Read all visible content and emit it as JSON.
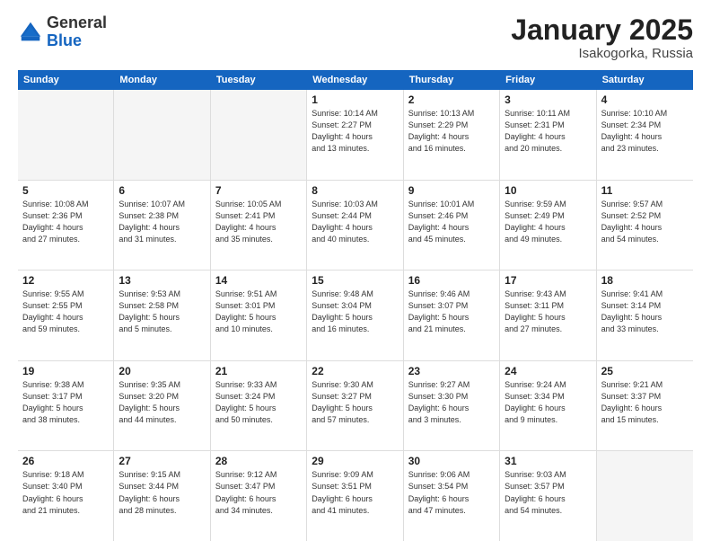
{
  "header": {
    "logo_general": "General",
    "logo_blue": "Blue",
    "month_title": "January 2025",
    "location": "Isakogorka, Russia"
  },
  "days_of_week": [
    "Sunday",
    "Monday",
    "Tuesday",
    "Wednesday",
    "Thursday",
    "Friday",
    "Saturday"
  ],
  "weeks": [
    [
      {
        "day": "",
        "info": "",
        "empty": true
      },
      {
        "day": "",
        "info": "",
        "empty": true
      },
      {
        "day": "",
        "info": "",
        "empty": true
      },
      {
        "day": "1",
        "info": "Sunrise: 10:14 AM\nSunset: 2:27 PM\nDaylight: 4 hours\nand 13 minutes.",
        "empty": false
      },
      {
        "day": "2",
        "info": "Sunrise: 10:13 AM\nSunset: 2:29 PM\nDaylight: 4 hours\nand 16 minutes.",
        "empty": false
      },
      {
        "day": "3",
        "info": "Sunrise: 10:11 AM\nSunset: 2:31 PM\nDaylight: 4 hours\nand 20 minutes.",
        "empty": false
      },
      {
        "day": "4",
        "info": "Sunrise: 10:10 AM\nSunset: 2:34 PM\nDaylight: 4 hours\nand 23 minutes.",
        "empty": false
      }
    ],
    [
      {
        "day": "5",
        "info": "Sunrise: 10:08 AM\nSunset: 2:36 PM\nDaylight: 4 hours\nand 27 minutes.",
        "empty": false
      },
      {
        "day": "6",
        "info": "Sunrise: 10:07 AM\nSunset: 2:38 PM\nDaylight: 4 hours\nand 31 minutes.",
        "empty": false
      },
      {
        "day": "7",
        "info": "Sunrise: 10:05 AM\nSunset: 2:41 PM\nDaylight: 4 hours\nand 35 minutes.",
        "empty": false
      },
      {
        "day": "8",
        "info": "Sunrise: 10:03 AM\nSunset: 2:44 PM\nDaylight: 4 hours\nand 40 minutes.",
        "empty": false
      },
      {
        "day": "9",
        "info": "Sunrise: 10:01 AM\nSunset: 2:46 PM\nDaylight: 4 hours\nand 45 minutes.",
        "empty": false
      },
      {
        "day": "10",
        "info": "Sunrise: 9:59 AM\nSunset: 2:49 PM\nDaylight: 4 hours\nand 49 minutes.",
        "empty": false
      },
      {
        "day": "11",
        "info": "Sunrise: 9:57 AM\nSunset: 2:52 PM\nDaylight: 4 hours\nand 54 minutes.",
        "empty": false
      }
    ],
    [
      {
        "day": "12",
        "info": "Sunrise: 9:55 AM\nSunset: 2:55 PM\nDaylight: 4 hours\nand 59 minutes.",
        "empty": false
      },
      {
        "day": "13",
        "info": "Sunrise: 9:53 AM\nSunset: 2:58 PM\nDaylight: 5 hours\nand 5 minutes.",
        "empty": false
      },
      {
        "day": "14",
        "info": "Sunrise: 9:51 AM\nSunset: 3:01 PM\nDaylight: 5 hours\nand 10 minutes.",
        "empty": false
      },
      {
        "day": "15",
        "info": "Sunrise: 9:48 AM\nSunset: 3:04 PM\nDaylight: 5 hours\nand 16 minutes.",
        "empty": false
      },
      {
        "day": "16",
        "info": "Sunrise: 9:46 AM\nSunset: 3:07 PM\nDaylight: 5 hours\nand 21 minutes.",
        "empty": false
      },
      {
        "day": "17",
        "info": "Sunrise: 9:43 AM\nSunset: 3:11 PM\nDaylight: 5 hours\nand 27 minutes.",
        "empty": false
      },
      {
        "day": "18",
        "info": "Sunrise: 9:41 AM\nSunset: 3:14 PM\nDaylight: 5 hours\nand 33 minutes.",
        "empty": false
      }
    ],
    [
      {
        "day": "19",
        "info": "Sunrise: 9:38 AM\nSunset: 3:17 PM\nDaylight: 5 hours\nand 38 minutes.",
        "empty": false
      },
      {
        "day": "20",
        "info": "Sunrise: 9:35 AM\nSunset: 3:20 PM\nDaylight: 5 hours\nand 44 minutes.",
        "empty": false
      },
      {
        "day": "21",
        "info": "Sunrise: 9:33 AM\nSunset: 3:24 PM\nDaylight: 5 hours\nand 50 minutes.",
        "empty": false
      },
      {
        "day": "22",
        "info": "Sunrise: 9:30 AM\nSunset: 3:27 PM\nDaylight: 5 hours\nand 57 minutes.",
        "empty": false
      },
      {
        "day": "23",
        "info": "Sunrise: 9:27 AM\nSunset: 3:30 PM\nDaylight: 6 hours\nand 3 minutes.",
        "empty": false
      },
      {
        "day": "24",
        "info": "Sunrise: 9:24 AM\nSunset: 3:34 PM\nDaylight: 6 hours\nand 9 minutes.",
        "empty": false
      },
      {
        "day": "25",
        "info": "Sunrise: 9:21 AM\nSunset: 3:37 PM\nDaylight: 6 hours\nand 15 minutes.",
        "empty": false
      }
    ],
    [
      {
        "day": "26",
        "info": "Sunrise: 9:18 AM\nSunset: 3:40 PM\nDaylight: 6 hours\nand 21 minutes.",
        "empty": false
      },
      {
        "day": "27",
        "info": "Sunrise: 9:15 AM\nSunset: 3:44 PM\nDaylight: 6 hours\nand 28 minutes.",
        "empty": false
      },
      {
        "day": "28",
        "info": "Sunrise: 9:12 AM\nSunset: 3:47 PM\nDaylight: 6 hours\nand 34 minutes.",
        "empty": false
      },
      {
        "day": "29",
        "info": "Sunrise: 9:09 AM\nSunset: 3:51 PM\nDaylight: 6 hours\nand 41 minutes.",
        "empty": false
      },
      {
        "day": "30",
        "info": "Sunrise: 9:06 AM\nSunset: 3:54 PM\nDaylight: 6 hours\nand 47 minutes.",
        "empty": false
      },
      {
        "day": "31",
        "info": "Sunrise: 9:03 AM\nSunset: 3:57 PM\nDaylight: 6 hours\nand 54 minutes.",
        "empty": false
      },
      {
        "day": "",
        "info": "",
        "empty": true
      }
    ]
  ]
}
